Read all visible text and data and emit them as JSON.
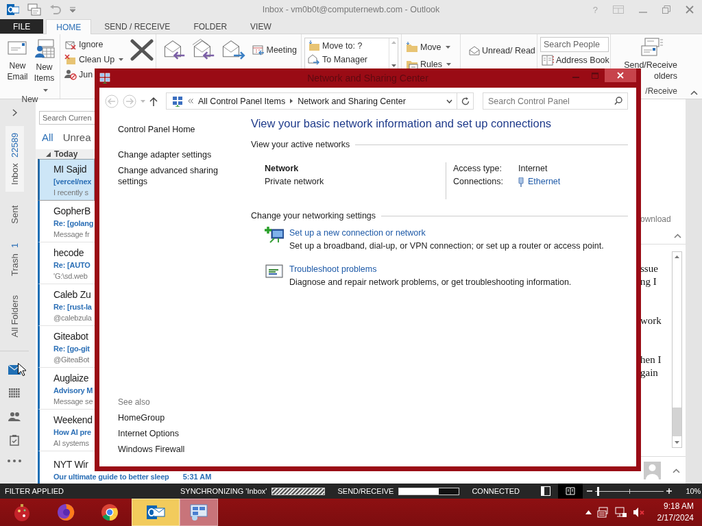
{
  "window": {
    "title": "Inbox - vm0b0t@computernewb.com - Outlook",
    "help": "?"
  },
  "ribbon_tabs": [
    {
      "label": "FILE",
      "kind": "backstage",
      "selected": false
    },
    {
      "label": "HOME",
      "kind": "tab",
      "selected": true
    },
    {
      "label": "SEND / RECEIVE",
      "kind": "tab",
      "selected": false
    },
    {
      "label": "FOLDER",
      "kind": "tab",
      "selected": false
    },
    {
      "label": "VIEW",
      "kind": "tab",
      "selected": false
    }
  ],
  "ribbon": {
    "new": {
      "label": "New",
      "buttons": [
        {
          "label": "New Email",
          "kind": "email",
          "dropdown": false
        },
        {
          "label": "New Items",
          "kind": "items",
          "dropdown": true
        }
      ]
    },
    "delete": [
      {
        "label": "Ignore",
        "kind": "ignore",
        "dropdown": false
      },
      {
        "label": "Clean Up",
        "kind": "cleanup",
        "dropdown": true
      },
      {
        "label": "Jun",
        "kind": "junk",
        "dropdown": false
      }
    ],
    "respond": {
      "meeting": "Meeting"
    },
    "quick_steps": [
      {
        "label": "Move to: ?",
        "kind": "move"
      },
      {
        "label": "To Manager",
        "kind": "forward"
      }
    ],
    "move": [
      {
        "label": "Move",
        "kind": "move",
        "dropdown": true
      },
      {
        "label": "Rules",
        "kind": "rules",
        "dropdown": true
      }
    ],
    "tags": {
      "unread_read": "Unread/ Read"
    },
    "find": {
      "placeholder": "Search People",
      "address_book": "Address Book"
    },
    "send_receive": {
      "lines": [
        "Send/Receive",
        "olders"
      ],
      "group_label": "/Receive"
    }
  },
  "navigation": {
    "folders": [
      {
        "label": "Inbox",
        "count": "22589",
        "selected": true
      },
      {
        "label": "Sent",
        "selected": false
      },
      {
        "label": "Trash",
        "count": "1",
        "selected": false
      },
      {
        "label": "All Folders",
        "selected": false
      }
    ],
    "modules": [
      {
        "kind": "mail",
        "selected": true
      },
      {
        "kind": "calendar",
        "selected": false
      },
      {
        "kind": "people",
        "selected": false
      },
      {
        "kind": "tasks",
        "selected": false
      },
      {
        "kind": "more",
        "selected": false
      }
    ]
  },
  "mail_list": {
    "search_placeholder": "Search Curren",
    "filters": [
      {
        "label": "All",
        "selected": true
      },
      {
        "label": "Unrea",
        "selected": false
      }
    ],
    "group": "Today",
    "items": [
      {
        "sender": "MI Sajid",
        "subject": "[vercel/nex",
        "preview": "I recently s",
        "selected": true
      },
      {
        "sender": "GopherB",
        "subject": "Re: [golang",
        "preview": "Message fr",
        "selected": false
      },
      {
        "sender": "hecode",
        "subject": "Re: [AUTO",
        "preview": "'G:\\sd.web",
        "selected": false
      },
      {
        "sender": "Caleb Zu",
        "subject": "Re: [rust-la",
        "preview": "@calebzula",
        "selected": false
      },
      {
        "sender": "Giteabot",
        "subject": "Re: [go-git",
        "preview": "@GiteaBot",
        "selected": false
      },
      {
        "sender": "Auglaize",
        "subject": "Advisory M",
        "preview": "Message se",
        "selected": false
      },
      {
        "sender": "Weekend",
        "subject": "How AI pre",
        "preview": "AI systems",
        "selected": false
      },
      {
        "sender": "NYT Wir",
        "subject": "Our ultimate guide to better sleep",
        "time": "5:31 AM",
        "selected": false
      }
    ]
  },
  "reading_pane": {
    "attachment_text": "ownload",
    "paragraphs": [
      [
        "ssue",
        "ng I"
      ],
      [
        "work"
      ],
      [
        "hen I",
        "gain"
      ]
    ]
  },
  "dialog": {
    "title": "Network and Sharing Center",
    "address": {
      "crumbs": [
        "All Control Panel Items",
        "Network and Sharing Center"
      ],
      "search_placeholder": "Search Control Panel"
    },
    "tasks_pane": {
      "links": [
        {
          "label": "Control Panel Home",
          "kind": "home"
        },
        {
          "label": "Change adapter settings",
          "kind": "task"
        },
        {
          "label": "Change advanced sharing settings",
          "kind": "task"
        }
      ],
      "see_also": {
        "heading": "See also",
        "links": [
          "HomeGroup",
          "Internet Options",
          "Windows Firewall"
        ]
      }
    },
    "heading": "View your basic network information and set up connections",
    "active_networks": {
      "heading": "View your active networks",
      "networks": [
        {
          "name": "Network",
          "category": "Private network",
          "access_label": "Access type:",
          "access": "Internet",
          "connections_label": "Connections:",
          "connection": "Ethernet"
        }
      ]
    },
    "settings": {
      "heading": "Change your networking settings",
      "tasks": [
        {
          "kind": "new-connection",
          "link": "Set up a new connection or network",
          "description": "Set up a broadband, dial-up, or VPN connection; or set up a router or access point."
        },
        {
          "kind": "troubleshoot",
          "link": "Troubleshoot problems",
          "description": "Diagnose and repair network problems, or get troubleshooting information."
        }
      ]
    }
  },
  "status_bar": {
    "filter": "FILTER APPLIED",
    "sync": {
      "label": "SYNCHRONIZING 'Inbox'",
      "busy": true
    },
    "send_receive": {
      "label": "SEND/RECEIVE",
      "level": 0.66
    },
    "connection": "CONNECTED",
    "views": [
      {
        "kind": "normal",
        "selected": false
      },
      {
        "kind": "reading",
        "selected": true
      }
    ],
    "zoom": {
      "level": 0.02,
      "reading": "10%"
    }
  },
  "taskbar": {
    "apps": [
      {
        "kind": "ornament",
        "flashing": false,
        "active": false
      },
      {
        "kind": "firefox",
        "flashing": false,
        "active": false
      },
      {
        "kind": "chrome",
        "flashing": false,
        "active": false
      },
      {
        "kind": "outlook",
        "flashing": true,
        "active": false
      },
      {
        "kind": "control-panel",
        "flashing": false,
        "active": true
      }
    ],
    "time": "9:18 AM",
    "date": "2/17/2024"
  }
}
